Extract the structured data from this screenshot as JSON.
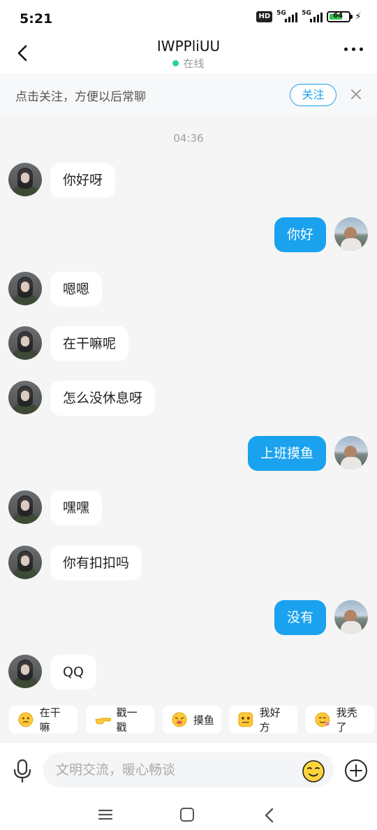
{
  "status_bar": {
    "time": "5:21",
    "hd_badge": "HD",
    "network_1": "5G",
    "network_2": "5G",
    "battery": "64"
  },
  "header": {
    "title": "IWPPliUU",
    "status": "在线"
  },
  "banner": {
    "text": "点击关注，方便以后常聊",
    "follow_label": "关注"
  },
  "chat": {
    "timestamp": "04:36",
    "messages": [
      {
        "from": "her",
        "text": "你好呀"
      },
      {
        "from": "me",
        "text": "你好"
      },
      {
        "from": "her",
        "text": "嗯嗯"
      },
      {
        "from": "her",
        "text": "在干嘛呢"
      },
      {
        "from": "her",
        "text": "怎么没休息呀"
      },
      {
        "from": "me",
        "text": "上班摸鱼"
      },
      {
        "from": "her",
        "text": "嘿嘿"
      },
      {
        "from": "her",
        "text": "你有扣扣吗"
      },
      {
        "from": "me",
        "text": "没有"
      },
      {
        "from": "her",
        "text": "QQ"
      }
    ]
  },
  "quick_replies": [
    {
      "icon": "thinking-emoji-icon",
      "label": "在干嘛"
    },
    {
      "icon": "pointing-hand-icon",
      "label": "戳一戳"
    },
    {
      "icon": "fish-emoji-icon",
      "label": "摸鱼"
    },
    {
      "icon": "drool-emoji-icon",
      "label": "我好方"
    },
    {
      "icon": "proud-emoji-icon",
      "label": "我秃了"
    }
  ],
  "input_bar": {
    "placeholder": "文明交流，暖心畅谈"
  },
  "colors": {
    "accent": "#1aa2ee",
    "online": "#2cd48c",
    "background": "#f5f5f5"
  }
}
